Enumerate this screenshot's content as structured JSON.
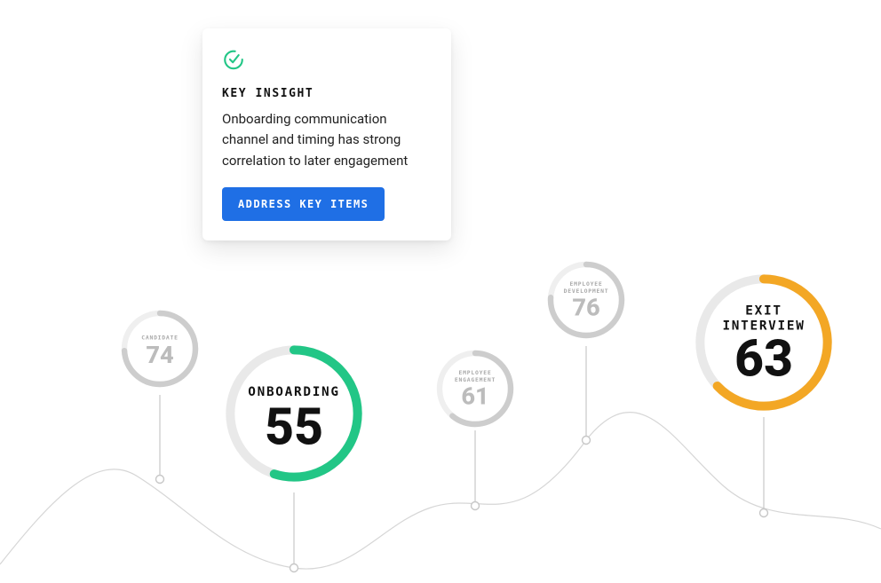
{
  "insight": {
    "heading": "KEY INSIGHT",
    "body": "Onboarding communication channel and timing has strong correlation to later engagement",
    "cta_label": "ADDRESS KEY ITEMS"
  },
  "icons": {
    "insight_check": "checkmark-circle"
  },
  "colors": {
    "accent_green": "#22c686",
    "accent_orange": "#f3a725",
    "cta_bg": "#1f6fe5",
    "ring_track": "#e6e6e6",
    "ring_track_dim": "#efefef",
    "curve_stroke": "#d6d6d6",
    "pin_stroke": "#c7c7c7"
  },
  "chart_data": {
    "type": "line",
    "title": "",
    "xlabel": "",
    "ylabel": "",
    "x": [
      "CANDIDATE",
      "ONBOARDING",
      "EMPLOYEE ENGAGEMENT",
      "EMPLOYEE DEVELOPMENT",
      "EXIT INTERVIEW"
    ],
    "values": [
      74,
      55,
      61,
      76,
      63
    ],
    "ylim": [
      0,
      100
    ],
    "series_meta": [
      {
        "key": "candidate",
        "color": "#e6e6e6",
        "emphasis": false
      },
      {
        "key": "onboarding",
        "color": "#22c686",
        "emphasis": true
      },
      {
        "key": "engagement",
        "color": "#e6e6e6",
        "emphasis": false
      },
      {
        "key": "development",
        "color": "#e6e6e6",
        "emphasis": false
      },
      {
        "key": "exit",
        "color": "#f3a725",
        "emphasis": true
      }
    ]
  },
  "nodes": {
    "candidate": {
      "label": "CANDIDATE",
      "value": "74",
      "percent": 74,
      "emphasis": false,
      "color_key": "ring_track"
    },
    "onboarding": {
      "label": "ONBOARDING",
      "value": "55",
      "percent": 55,
      "emphasis": true,
      "color_key": "accent_green"
    },
    "engagement": {
      "label": "EMPLOYEE ENGAGEMENT",
      "value": "61",
      "percent": 61,
      "emphasis": false,
      "color_key": "ring_track"
    },
    "development": {
      "label": "EMPLOYEE DEVELOPMENT",
      "value": "76",
      "percent": 76,
      "emphasis": false,
      "color_key": "ring_track"
    },
    "exit": {
      "label": "EXIT INTERVIEW",
      "value": "63",
      "percent": 63,
      "emphasis": true,
      "color_key": "accent_orange"
    }
  }
}
